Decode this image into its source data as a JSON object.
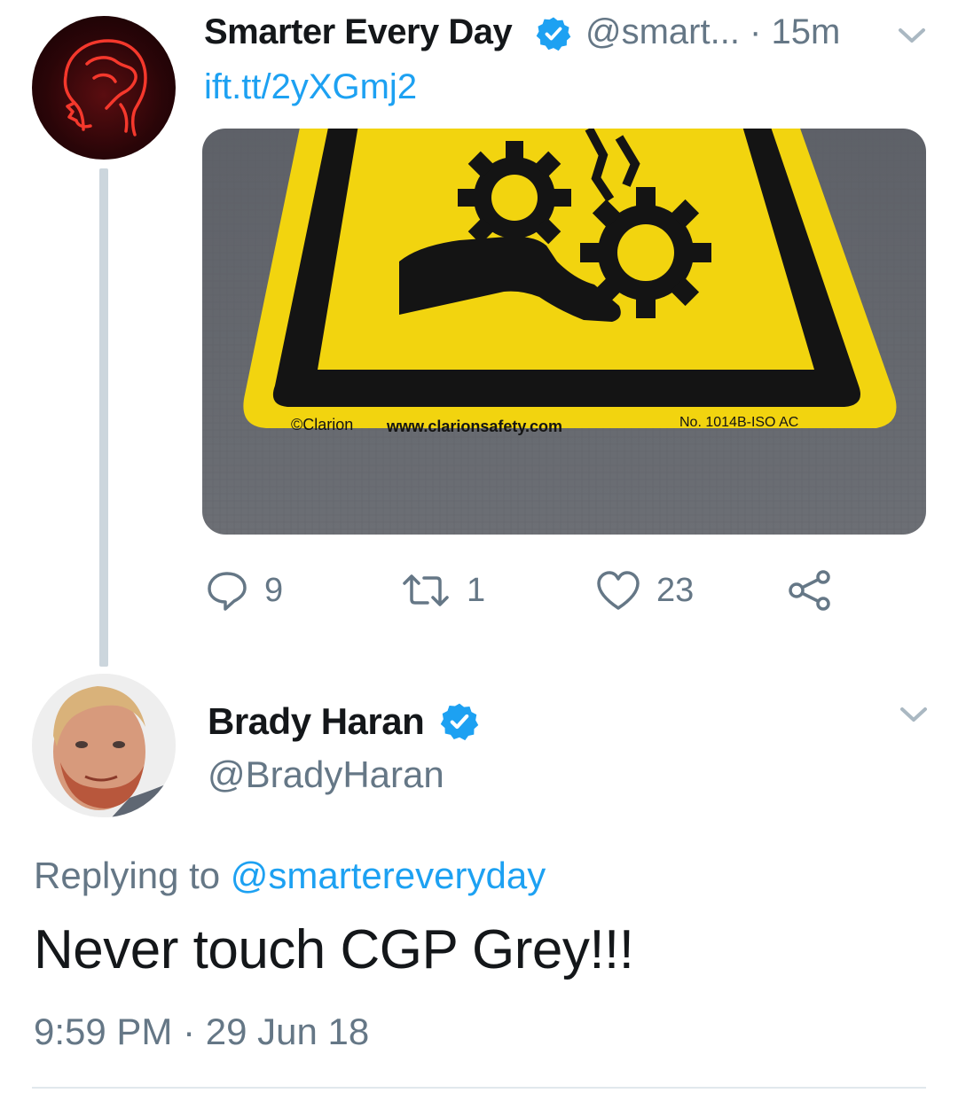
{
  "colors": {
    "accent": "#1da1f2",
    "secondary_text": "#657786",
    "thread_line": "#ccd6dd",
    "sign_yellow": "#f2d40f"
  },
  "tweet1": {
    "display_name": "Smarter Every Day",
    "handle_time": "@smart... · 15m",
    "link": "ift.tt/2yXGmj2",
    "image": {
      "sign_brand": "©Clarion",
      "sign_url": "www.clarionsafety.com",
      "sign_number": "No. 1014B-ISO AC"
    },
    "actions": {
      "replies": "9",
      "retweets": "1",
      "likes": "23"
    },
    "icons": [
      "verified-badge-icon",
      "chevron-down-icon",
      "reply-icon",
      "retweet-icon",
      "like-icon",
      "share-icon"
    ]
  },
  "tweet2": {
    "display_name": "Brady Haran",
    "handle": "@BradyHaran",
    "replying_prefix": "Replying to ",
    "replying_mention": "@smartereveryday",
    "text": "Never touch CGP Grey!!!",
    "timestamp": "9:59 PM · 29 Jun 18"
  }
}
